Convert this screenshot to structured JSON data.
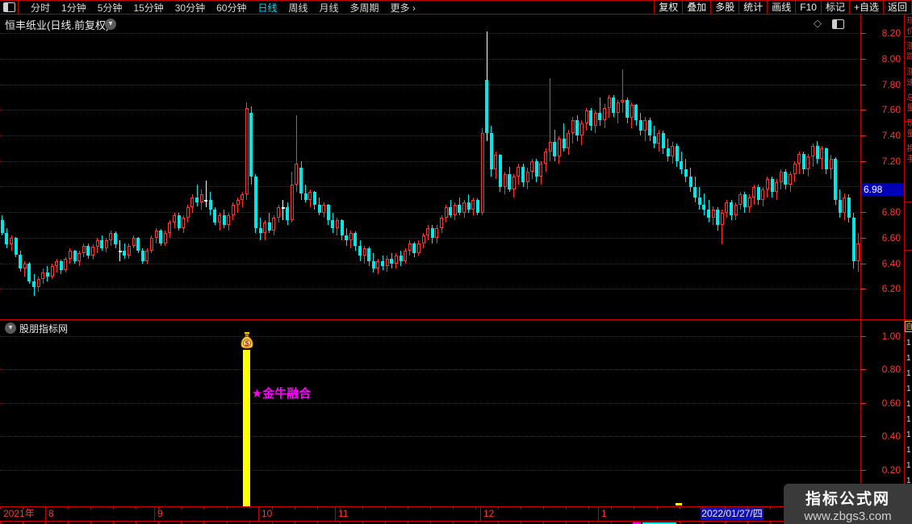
{
  "title_bar": {
    "title": "恒丰纸业(日线.前复权)"
  },
  "toolbar": {
    "left_tabs": [
      {
        "label": "分时",
        "active": false
      },
      {
        "label": "1分钟",
        "active": false
      },
      {
        "label": "5分钟",
        "active": false
      },
      {
        "label": "15分钟",
        "active": false
      },
      {
        "label": "30分钟",
        "active": false
      },
      {
        "label": "60分钟",
        "active": false
      },
      {
        "label": "日线",
        "active": true
      },
      {
        "label": "周线",
        "active": false
      },
      {
        "label": "月线",
        "active": false
      },
      {
        "label": "多周期",
        "active": false
      },
      {
        "label": "更多 ›",
        "active": false
      }
    ],
    "right_buttons": [
      "复权",
      "叠加",
      "多股",
      "统计",
      "画线",
      "F10",
      "标记",
      "+自选",
      "返回"
    ]
  },
  "price_axis": {
    "tick_values": [
      8.2,
      8.0,
      7.8,
      7.6,
      7.4,
      7.2,
      6.8,
      6.6,
      6.4,
      6.2
    ],
    "current_price_tag": "6.98"
  },
  "indicator_panel": {
    "name": "股朋指标网",
    "signal_label": "★金牛融合",
    "tick_values": [
      1.0,
      0.8,
      0.6,
      0.4,
      0.2
    ]
  },
  "date_axis": {
    "year_label": "2021年",
    "months": [
      {
        "label": "8",
        "candle_index": 10
      },
      {
        "label": "9",
        "candle_index": 34
      },
      {
        "label": "10",
        "candle_index": 57
      },
      {
        "label": "11",
        "candle_index": 74
      },
      {
        "label": "12",
        "candle_index": 106
      },
      {
        "label": "1",
        "candle_index": 132
      }
    ],
    "current_date_tag": "2022/01/27/四"
  },
  "right_strip": {
    "top_items": [
      "现价",
      "涨跌",
      "涨速",
      "总量",
      "现量",
      "换手"
    ],
    "list_header": "自",
    "list_rows": [
      "1",
      "1",
      "1",
      "1",
      "1",
      "1",
      "1",
      "1",
      "1",
      "1"
    ]
  },
  "watermark": {
    "line1": "指标公式网",
    "line2": "www.zbgs3.com"
  },
  "colors": {
    "up": "#ff3232",
    "down": "#00e8e8",
    "doji": "#ffffff",
    "grid": "#a00000",
    "frame": "#c00000",
    "axis_text": "#fa3737",
    "active_tab": "#00d9ff",
    "price_tag_bg": "#0000b4",
    "date_tag_bg": "#1212b0",
    "signal_text": "#ff00ff",
    "signal_bar": "#ffff00"
  },
  "chart_data": {
    "type": "candlestick",
    "symbol": "恒丰纸业",
    "period": "日线",
    "adjust": "前复权",
    "y_axis_range": [
      6.2,
      8.2
    ],
    "grid_step": 0.2,
    "grid_levels": [
      8.2,
      8.0,
      7.8,
      7.6,
      7.4,
      7.2,
      7.0,
      6.8,
      6.6,
      6.4,
      6.2
    ],
    "last_price": 6.98,
    "candles": [
      [
        6.74,
        6.78,
        6.62,
        6.64
      ],
      [
        6.64,
        6.68,
        6.52,
        6.55
      ],
      [
        6.55,
        6.62,
        6.5,
        6.6
      ],
      [
        6.6,
        6.61,
        6.45,
        6.47
      ],
      [
        6.47,
        6.5,
        6.34,
        6.36
      ],
      [
        6.36,
        6.42,
        6.3,
        6.4
      ],
      [
        6.4,
        6.41,
        6.24,
        6.26
      ],
      [
        6.26,
        6.32,
        6.15,
        6.22
      ],
      [
        6.22,
        6.3,
        6.18,
        6.28
      ],
      [
        6.28,
        6.36,
        6.24,
        6.33
      ],
      [
        6.33,
        6.38,
        6.26,
        6.3
      ],
      [
        6.3,
        6.4,
        6.28,
        6.38
      ],
      [
        6.38,
        6.44,
        6.33,
        6.42
      ],
      [
        6.42,
        6.43,
        6.32,
        6.35
      ],
      [
        6.35,
        6.45,
        6.33,
        6.44
      ],
      [
        6.44,
        6.52,
        6.4,
        6.5
      ],
      [
        6.5,
        6.51,
        6.4,
        6.42
      ],
      [
        6.42,
        6.5,
        6.38,
        6.48
      ],
      [
        6.48,
        6.56,
        6.45,
        6.54
      ],
      [
        6.54,
        6.56,
        6.44,
        6.46
      ],
      [
        6.46,
        6.55,
        6.43,
        6.53
      ],
      [
        6.53,
        6.6,
        6.48,
        6.58
      ],
      [
        6.58,
        6.62,
        6.5,
        6.52
      ],
      [
        6.52,
        6.6,
        6.49,
        6.58
      ],
      [
        6.58,
        6.66,
        6.54,
        6.64
      ],
      [
        6.64,
        6.65,
        6.52,
        6.55
      ],
      [
        6.5,
        6.58,
        6.42,
        6.5
      ],
      [
        6.5,
        6.56,
        6.44,
        6.46
      ],
      [
        6.46,
        6.56,
        6.44,
        6.54
      ],
      [
        6.54,
        6.62,
        6.52,
        6.6
      ],
      [
        6.6,
        6.61,
        6.48,
        6.5
      ],
      [
        6.5,
        6.52,
        6.4,
        6.42
      ],
      [
        6.42,
        6.52,
        6.4,
        6.5
      ],
      [
        6.5,
        6.62,
        6.48,
        6.6
      ],
      [
        6.6,
        6.68,
        6.56,
        6.66
      ],
      [
        6.66,
        6.67,
        6.54,
        6.56
      ],
      [
        6.56,
        6.66,
        6.54,
        6.64
      ],
      [
        6.64,
        6.74,
        6.6,
        6.72
      ],
      [
        6.72,
        6.8,
        6.68,
        6.78
      ],
      [
        6.78,
        6.8,
        6.66,
        6.68
      ],
      [
        6.68,
        6.78,
        6.64,
        6.76
      ],
      [
        6.76,
        6.86,
        6.72,
        6.84
      ],
      [
        6.84,
        6.94,
        6.8,
        6.92
      ],
      [
        6.92,
        7.02,
        6.85,
        6.88
      ],
      [
        6.88,
        6.98,
        6.82,
        6.94
      ],
      [
        6.9,
        7.05,
        6.84,
        6.9
      ],
      [
        6.9,
        6.96,
        6.78,
        6.82
      ],
      [
        6.82,
        6.84,
        6.7,
        6.72
      ],
      [
        6.72,
        6.8,
        6.66,
        6.78
      ],
      [
        6.78,
        6.82,
        6.68,
        6.7
      ],
      [
        6.7,
        6.8,
        6.66,
        6.78
      ],
      [
        6.78,
        6.88,
        6.74,
        6.86
      ],
      [
        6.86,
        6.92,
        6.8,
        6.9
      ],
      [
        6.9,
        6.96,
        6.84,
        6.94
      ],
      [
        6.94,
        7.66,
        6.9,
        7.62
      ],
      [
        7.58,
        7.63,
        7.02,
        7.08
      ],
      [
        7.08,
        7.1,
        6.64,
        6.68
      ],
      [
        6.68,
        6.76,
        6.58,
        6.64
      ],
      [
        6.64,
        6.74,
        6.58,
        6.72
      ],
      [
        6.72,
        6.8,
        6.64,
        6.66
      ],
      [
        6.66,
        6.78,
        6.62,
        6.76
      ],
      [
        6.76,
        6.86,
        6.72,
        6.84
      ],
      [
        6.84,
        6.9,
        6.74,
        6.84
      ],
      [
        6.84,
        6.88,
        6.7,
        6.74
      ],
      [
        6.74,
        7.12,
        6.72,
        7.02
      ],
      [
        7.02,
        7.56,
        6.96,
        7.18
      ],
      [
        7.15,
        7.2,
        6.9,
        6.95
      ],
      [
        6.95,
        7.02,
        6.88,
        6.9
      ],
      [
        6.9,
        6.98,
        6.84,
        6.96
      ],
      [
        6.96,
        6.97,
        6.82,
        6.86
      ],
      [
        6.86,
        6.92,
        6.78,
        6.8
      ],
      [
        6.8,
        6.88,
        6.76,
        6.86
      ],
      [
        6.86,
        6.87,
        6.7,
        6.74
      ],
      [
        6.74,
        6.8,
        6.64,
        6.68
      ],
      [
        6.68,
        6.76,
        6.62,
        6.74
      ],
      [
        6.74,
        6.75,
        6.58,
        6.62
      ],
      [
        6.62,
        6.68,
        6.54,
        6.58
      ],
      [
        6.58,
        6.66,
        6.52,
        6.64
      ],
      [
        6.64,
        6.65,
        6.5,
        6.54
      ],
      [
        6.54,
        6.58,
        6.42,
        6.46
      ],
      [
        6.46,
        6.54,
        6.4,
        6.52
      ],
      [
        6.52,
        6.53,
        6.38,
        6.42
      ],
      [
        6.42,
        6.48,
        6.33,
        6.36
      ],
      [
        6.36,
        6.44,
        6.32,
        6.42
      ],
      [
        6.42,
        6.46,
        6.35,
        6.38
      ],
      [
        6.38,
        6.46,
        6.34,
        6.44
      ],
      [
        6.44,
        6.48,
        6.36,
        6.4
      ],
      [
        6.4,
        6.48,
        6.36,
        6.46
      ],
      [
        6.46,
        6.5,
        6.38,
        6.42
      ],
      [
        6.42,
        6.52,
        6.4,
        6.5
      ],
      [
        6.5,
        6.58,
        6.46,
        6.56
      ],
      [
        6.56,
        6.57,
        6.45,
        6.48
      ],
      [
        6.48,
        6.58,
        6.46,
        6.56
      ],
      [
        6.56,
        6.64,
        6.52,
        6.62
      ],
      [
        6.62,
        6.7,
        6.58,
        6.68
      ],
      [
        6.68,
        6.7,
        6.56,
        6.6
      ],
      [
        6.6,
        6.7,
        6.56,
        6.68
      ],
      [
        6.68,
        6.78,
        6.64,
        6.76
      ],
      [
        6.76,
        6.86,
        6.72,
        6.84
      ],
      [
        6.84,
        6.9,
        6.76,
        6.78
      ],
      [
        6.78,
        6.88,
        6.74,
        6.86
      ],
      [
        6.86,
        6.92,
        6.78,
        6.8
      ],
      [
        6.8,
        6.9,
        6.76,
        6.88
      ],
      [
        6.88,
        6.94,
        6.8,
        6.82
      ],
      [
        6.82,
        6.92,
        6.78,
        6.9
      ],
      [
        6.9,
        6.91,
        6.78,
        6.8
      ],
      [
        6.8,
        7.46,
        6.78,
        7.42
      ],
      [
        7.84,
        8.22,
        7.36,
        7.42,
        "w"
      ],
      [
        7.42,
        7.48,
        7.08,
        7.14
      ],
      [
        7.14,
        7.28,
        7.06,
        7.25
      ],
      [
        7.25,
        7.26,
        6.96,
        7.0
      ],
      [
        7.0,
        7.12,
        6.94,
        7.1
      ],
      [
        7.1,
        7.16,
        6.96,
        6.98
      ],
      [
        6.98,
        7.1,
        6.92,
        7.08
      ],
      [
        7.08,
        7.18,
        7.02,
        7.16
      ],
      [
        7.16,
        7.18,
        7.0,
        7.04
      ],
      [
        7.04,
        7.15,
        6.98,
        7.12
      ],
      [
        7.12,
        7.22,
        7.06,
        7.2
      ],
      [
        7.2,
        7.22,
        7.04,
        7.08
      ],
      [
        7.08,
        7.2,
        7.02,
        7.18
      ],
      [
        7.18,
        7.3,
        7.12,
        7.28
      ],
      [
        7.28,
        7.85,
        7.2,
        7.35
      ],
      [
        7.35,
        7.45,
        7.2,
        7.24
      ],
      [
        7.24,
        7.4,
        7.18,
        7.38
      ],
      [
        7.38,
        7.5,
        7.28,
        7.3
      ],
      [
        7.3,
        7.45,
        7.25,
        7.42
      ],
      [
        7.42,
        7.55,
        7.34,
        7.52
      ],
      [
        7.52,
        7.56,
        7.36,
        7.4
      ],
      [
        7.4,
        7.52,
        7.33,
        7.5
      ],
      [
        7.5,
        7.62,
        7.44,
        7.6
      ],
      [
        7.6,
        7.62,
        7.44,
        7.48
      ],
      [
        7.48,
        7.6,
        7.42,
        7.58
      ],
      [
        7.58,
        7.7,
        7.48,
        7.52
      ],
      [
        7.52,
        7.65,
        7.46,
        7.62
      ],
      [
        7.62,
        7.72,
        7.54,
        7.7
      ],
      [
        7.7,
        7.72,
        7.55,
        7.58
      ],
      [
        7.58,
        7.68,
        7.5,
        7.66
      ],
      [
        7.66,
        7.92,
        7.58,
        7.68
      ],
      [
        7.68,
        7.7,
        7.5,
        7.54
      ],
      [
        7.54,
        7.66,
        7.46,
        7.64
      ],
      [
        7.64,
        7.65,
        7.48,
        7.52
      ],
      [
        7.52,
        7.58,
        7.4,
        7.44
      ],
      [
        7.44,
        7.55,
        7.36,
        7.52
      ],
      [
        7.52,
        7.54,
        7.36,
        7.4
      ],
      [
        7.4,
        7.48,
        7.3,
        7.34
      ],
      [
        7.34,
        7.45,
        7.28,
        7.42
      ],
      [
        7.42,
        7.44,
        7.26,
        7.3
      ],
      [
        7.3,
        7.38,
        7.2,
        7.24
      ],
      [
        7.24,
        7.35,
        7.18,
        7.32
      ],
      [
        7.32,
        7.34,
        7.16,
        7.2
      ],
      [
        7.2,
        7.28,
        7.1,
        7.14
      ],
      [
        7.14,
        7.22,
        7.04,
        7.08
      ],
      [
        7.08,
        7.15,
        6.96,
        7.0
      ],
      [
        7.0,
        7.08,
        6.88,
        6.92
      ],
      [
        6.92,
        7.0,
        6.82,
        6.86
      ],
      [
        6.86,
        6.95,
        6.78,
        6.82
      ],
      [
        6.82,
        6.9,
        6.72,
        6.76
      ],
      [
        6.76,
        6.85,
        6.7,
        6.82
      ],
      [
        6.82,
        6.84,
        6.66,
        6.7
      ],
      [
        6.7,
        6.82,
        6.55,
        6.8
      ],
      [
        6.8,
        6.9,
        6.76,
        6.88
      ],
      [
        6.88,
        6.9,
        6.74,
        6.78
      ],
      [
        6.78,
        6.88,
        6.74,
        6.86
      ],
      [
        6.86,
        6.96,
        6.82,
        6.94
      ],
      [
        6.94,
        6.96,
        6.8,
        6.84
      ],
      [
        6.84,
        6.94,
        6.8,
        6.92
      ],
      [
        6.92,
        7.02,
        6.86,
        7.0
      ],
      [
        7.0,
        7.02,
        6.86,
        6.9
      ],
      [
        6.9,
        7.0,
        6.85,
        6.98
      ],
      [
        6.98,
        7.08,
        6.92,
        7.06
      ],
      [
        7.06,
        7.08,
        6.92,
        6.96
      ],
      [
        6.96,
        7.06,
        6.9,
        7.04
      ],
      [
        7.04,
        7.14,
        6.98,
        7.12
      ],
      [
        7.12,
        7.14,
        6.98,
        7.02
      ],
      [
        7.02,
        7.12,
        6.96,
        7.1
      ],
      [
        7.1,
        7.2,
        7.04,
        7.18
      ],
      [
        7.18,
        7.28,
        7.1,
        7.26
      ],
      [
        7.26,
        7.28,
        7.1,
        7.14
      ],
      [
        7.14,
        7.26,
        7.08,
        7.24
      ],
      [
        7.24,
        7.34,
        7.16,
        7.32
      ],
      [
        7.32,
        7.36,
        7.18,
        7.22
      ],
      [
        7.22,
        7.32,
        7.14,
        7.3
      ],
      [
        7.3,
        7.31,
        7.1,
        7.14
      ],
      [
        7.14,
        7.25,
        7.06,
        7.22
      ],
      [
        7.22,
        7.23,
        6.86,
        6.9
      ],
      [
        6.9,
        6.98,
        6.76,
        6.8
      ],
      [
        6.8,
        6.95,
        6.74,
        6.92
      ],
      [
        6.92,
        6.94,
        6.72,
        6.76
      ],
      [
        6.76,
        6.8,
        6.36,
        6.42
      ],
      [
        6.42,
        6.64,
        6.34,
        6.56
      ]
    ],
    "indicator": {
      "type": "bar",
      "panel_name": "股朋指标网",
      "range": [
        0,
        1.05
      ],
      "grid_levels": [
        1.0,
        0.8,
        0.6,
        0.4,
        0.2
      ],
      "bars": [
        {
          "candle_index": 54,
          "value": 0.92,
          "label": "金牛融合",
          "icon": "money-bag"
        }
      ]
    }
  }
}
